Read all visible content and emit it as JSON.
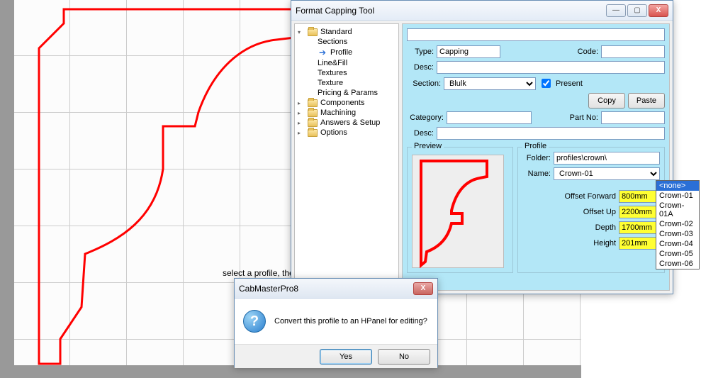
{
  "canvas": {
    "hint": "select a profile, then right click on its preview picture"
  },
  "fct": {
    "title": "Format Capping Tool",
    "winbtns": {
      "min": "—",
      "max": "▢",
      "close": "X"
    },
    "tree": {
      "standard": "Standard",
      "sections": "Sections",
      "profile": "Profile",
      "linefill": "Line&Fill",
      "textures": "Textures",
      "texture": "Texture",
      "pricing": "Pricing & Params",
      "components": "Components",
      "machining": "Machining",
      "answers": "Answers & Setup",
      "options": "Options"
    },
    "labels": {
      "type": "Type:",
      "code": "Code:",
      "desc": "Desc:",
      "section": "Section:",
      "present": "Present",
      "copy": "Copy",
      "paste": "Paste",
      "category": "Category:",
      "partno": "Part No:",
      "desc2": "Desc:",
      "preview": "Preview",
      "profile": "Profile",
      "folder": "Folder:",
      "name": "Name:",
      "offset_fwd": "Offset Forward",
      "offset_up": "Offset Up",
      "depth": "Depth",
      "height": "Height"
    },
    "values": {
      "type": "Capping",
      "code": "",
      "desc": "",
      "section": "Blulk",
      "present": true,
      "category": "",
      "partno": "",
      "desc2": "",
      "folder": "profiles\\crown\\",
      "name": "Crown-01",
      "offset_fwd": "800mm",
      "offset_up": "2200mm",
      "depth": "1700mm",
      "height": "201mm"
    },
    "name_options": [
      "<none>",
      "Crown-01",
      "Crown-01A",
      "Crown-02",
      "Crown-03",
      "Crown-04",
      "Crown-05",
      "Crown-06"
    ]
  },
  "msgbox": {
    "title": "CabMasterPro8",
    "text": "Convert this profile to an HPanel for editing?",
    "yes": "Yes",
    "no": "No",
    "close": "X"
  }
}
